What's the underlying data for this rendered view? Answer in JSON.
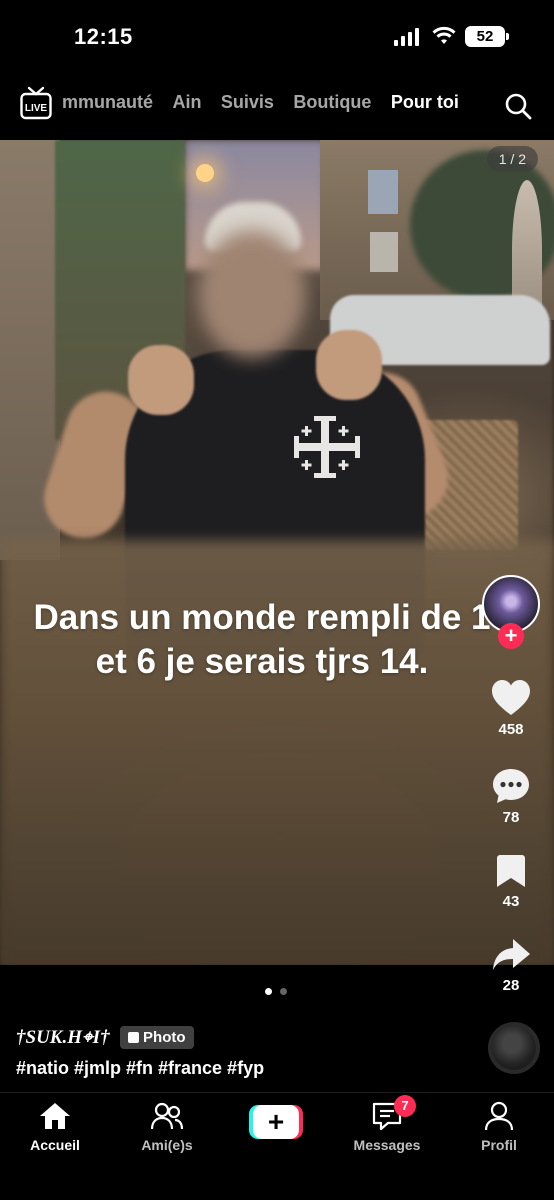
{
  "status_bar": {
    "time": "12:15",
    "battery": "52"
  },
  "top_nav": {
    "live_label": "LIVE",
    "tabs": [
      {
        "label": "mmunauté"
      },
      {
        "label": "Ain"
      },
      {
        "label": "Suivis"
      },
      {
        "label": "Boutique"
      },
      {
        "label": "Pour toi"
      }
    ],
    "active_tab": "Pour toi"
  },
  "post": {
    "image_counter": "1 / 2",
    "caption": "Dans un monde rempli de 1 et 6 je serais tjrs 14.",
    "author": "†SUK.H⌖I†",
    "type_badge": "Photo",
    "hashtags": "#natio #jmlp #fn #france #fyp"
  },
  "rail": {
    "likes": "458",
    "comments": "78",
    "saves": "43",
    "shares": "28"
  },
  "bottom_nav": {
    "items": [
      {
        "label": "Accueil",
        "icon": "home-icon"
      },
      {
        "label": "Ami(e)s",
        "icon": "friends-icon"
      },
      {
        "label": "",
        "icon": "create-icon"
      },
      {
        "label": "Messages",
        "icon": "messages-icon"
      },
      {
        "label": "Profil",
        "icon": "profile-icon"
      }
    ],
    "messages_badge": "7"
  },
  "colors": {
    "accent_red": "#fe2c55",
    "accent_cyan": "#25f4ee"
  }
}
